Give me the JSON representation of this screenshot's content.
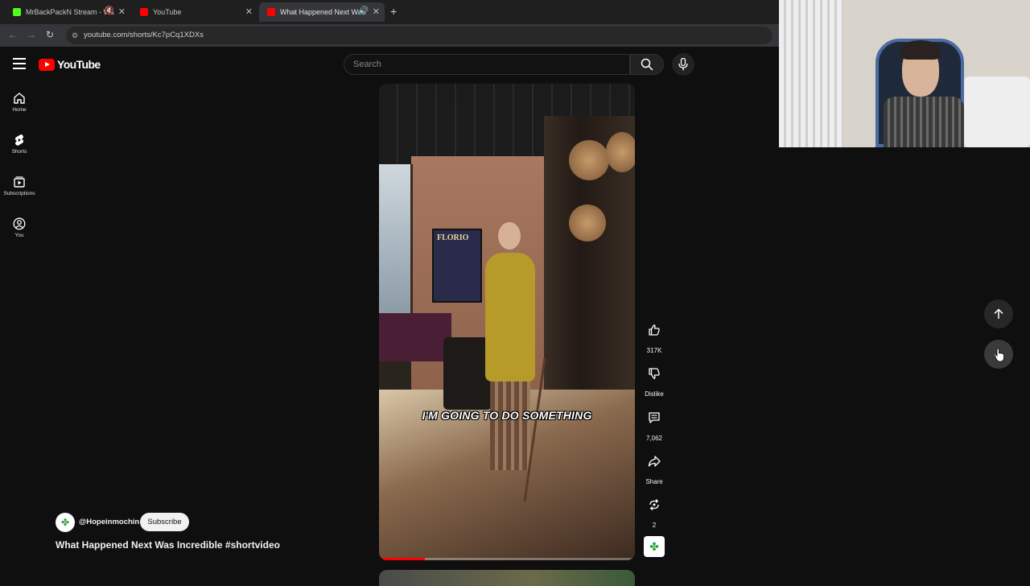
{
  "browser": {
    "tabs": [
      {
        "title": "MrBackPackN Stream - Wa",
        "favicon_color": "#53fc18",
        "active": false
      },
      {
        "title": "YouTube",
        "favicon_color": "#ff0000",
        "active": false
      },
      {
        "title": "What Happened Next Was",
        "favicon_color": "#ff0000",
        "active": true
      }
    ],
    "url": "youtube.com/shorts/Kc7pCq1XDXs"
  },
  "header": {
    "logo_text": "YouTube",
    "search_placeholder": "Search"
  },
  "sidebar": {
    "items": [
      {
        "label": "Home",
        "icon": "home-icon"
      },
      {
        "label": "Shorts",
        "icon": "shorts-icon"
      },
      {
        "label": "Subscriptions",
        "icon": "subscriptions-icon"
      },
      {
        "label": "You",
        "icon": "you-icon"
      }
    ]
  },
  "video": {
    "caption": "I'M GOING TO DO SOMETHING",
    "poster_text": "FLORIO",
    "progress": 0.18
  },
  "actions": {
    "like_count": "317K",
    "dislike_label": "Dislike",
    "comment_count": "7,062",
    "share_label": "Share",
    "remix_count": "2"
  },
  "channel": {
    "handle": "@Hopeinmochin",
    "subscribe_label": "Subscribe",
    "video_title": "What Happened Next Was Incredible #shortvideo"
  },
  "colors": {
    "brand_red": "#ff0000",
    "background": "#0f0f0f",
    "channel_green": "#2e9e3e"
  }
}
